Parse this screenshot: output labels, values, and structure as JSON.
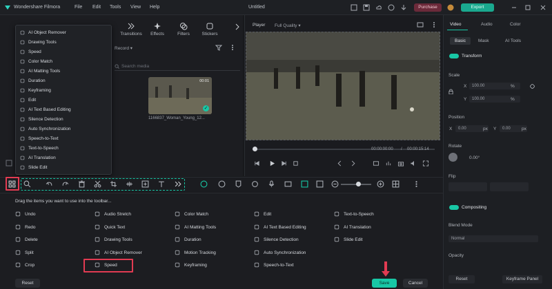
{
  "titlebar": {
    "app": "Wondershare Filmora",
    "menus": [
      "File",
      "Edit",
      "Tools",
      "View",
      "Help"
    ],
    "project": "Untitled",
    "purchase": "Purchase",
    "export": "Export"
  },
  "media_tabs": [
    "Transitions",
    "Effects",
    "Filters",
    "Stickers"
  ],
  "media": {
    "record": "Record",
    "search_placeholder": "Search media",
    "thumb_time": "00:01",
    "thumb_caption": "1166837_Woman_Young_12..."
  },
  "dropdown": {
    "items": [
      "AI Object Remover",
      "Drawing Tools",
      "Speed",
      "Color Match",
      "AI Matting Tools",
      "Duration",
      "Keyframing",
      "Edit",
      "AI Text Based Editing",
      "Silence Detection",
      "Auto Synchronization",
      "Speech-to-Text",
      "Text-to-Speech",
      "AI Translation",
      "Slide Edit"
    ]
  },
  "player": {
    "label": "Player",
    "quality": "Full Quality",
    "time_current": "00:00:00:00",
    "time_total": "00:00:15:14"
  },
  "right_panel": {
    "tabs": [
      "Video",
      "Audio",
      "Color"
    ],
    "subtabs": [
      "Basic",
      "Mask",
      "AI Tools"
    ],
    "transform": "Transform",
    "scale": "Scale",
    "scale_x_label": "X",
    "scale_x": "100.00",
    "scale_y_label": "Y",
    "scale_y": "100.00",
    "percent": "%",
    "position": "Position",
    "pos_x_label": "X",
    "pos_x": "0.00",
    "pos_y_label": "Y",
    "pos_y": "0.00",
    "px": "px",
    "rotate": "Rotate",
    "rotate_val": "0.00°",
    "flip": "Flip",
    "compositing": "Compositing",
    "blend_mode": "Blend Mode",
    "blend_val": "Normal",
    "opacity": "Opacity",
    "reset": "Reset",
    "keyframe_panel": "Keyframe Panel"
  },
  "customize": {
    "hint": "Drag the items you want to use into the toolbar...",
    "col1": [
      "Undo",
      "Redo",
      "Delete",
      "Split",
      "Crop"
    ],
    "col2": [
      "Audio Stretch",
      "Quick Text",
      "Drawing Tools",
      "AI Object Remover",
      "Speed"
    ],
    "col3": [
      "Color Match",
      "AI Matting Tools",
      "Duration",
      "Motion Tracking",
      "Keyframing"
    ],
    "col4": [
      "Edit",
      "AI Text Based Editing",
      "Silence Detection",
      "Auto Synchronization",
      "Speech-to-Text"
    ],
    "col5": [
      "Text-to-Speech",
      "AI Translation",
      "Slide Edit"
    ],
    "reset": "Reset",
    "save": "Save",
    "cancel": "Cancel"
  },
  "colors": {
    "accent": "#18c7a5",
    "highlight": "#e23b52",
    "purchase": "#6b2a3a"
  }
}
